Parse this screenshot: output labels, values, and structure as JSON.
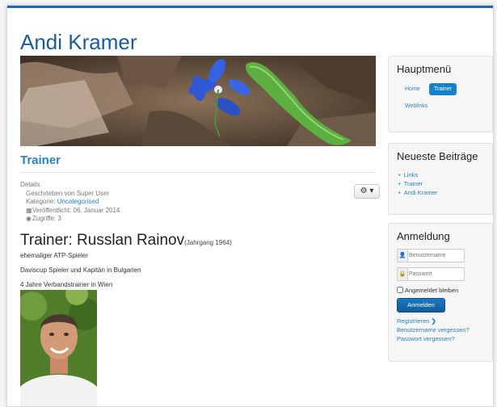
{
  "site": {
    "title": "Andi Kramer"
  },
  "article": {
    "title": "Trainer",
    "details": {
      "heading": "Details",
      "author": "Geschrieben von Super User",
      "category_label": "Kategorie: ",
      "category_value": "Uncategorised",
      "published": "Veröffentlicht: 06. Januar 2014",
      "hits": "Zugriffe: 3"
    },
    "headline": "Trainer: Russlan Rainov",
    "headline_note": "(Jahrgang 1964)",
    "paragraphs": [
      "ehemaliger ATP-Spieler",
      "Daviscup Spieler und Kapitän in Bulgarien",
      "4 Jahre Verbandstrainer in Wien"
    ],
    "tools_icon": "gear-icon"
  },
  "main_menu": {
    "title": "Hauptmenü",
    "items": [
      "Home",
      "Trainer",
      "Weblinks"
    ],
    "active": "Trainer",
    "active_color": "#1682c9"
  },
  "latest": {
    "title": "Neueste Beiträge",
    "items": [
      "Links",
      "Trainer",
      "Andi Kramer"
    ]
  },
  "login": {
    "title": "Anmeldung",
    "username_placeholder": "Benutzername",
    "password_placeholder": "Passwort",
    "remember_label": "Angemeldet bleiben",
    "submit_label": "Anmelden",
    "register_label": "Registrieren",
    "forgot_username": "Benutzername vergessen?",
    "forgot_password": "Passwort vergessen?"
  },
  "colors": {
    "accent": "#1b5c95",
    "link": "#2b83c0"
  }
}
